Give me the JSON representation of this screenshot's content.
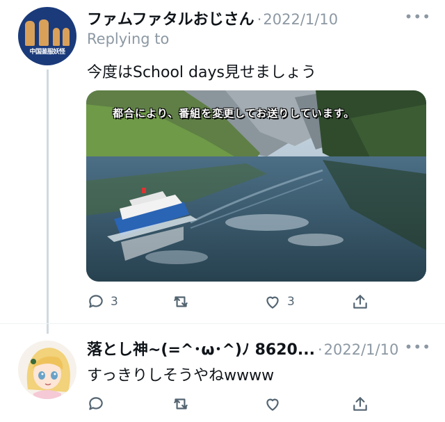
{
  "tweet1": {
    "display_name": "ファムファタルおじさん",
    "separator": "·",
    "date": "2022/1/10",
    "more_label": "•••",
    "replying_to": "Replying to",
    "text": "今度はSchool days見せましょう",
    "media_caption": "都合により、番組を変更してお送りしています。",
    "avatar_caption": "中国鉴服妖怪",
    "actions": {
      "reply_count": "3",
      "like_count": "3"
    }
  },
  "tweet2": {
    "display_name": "落とし神~(=^･ω･^)ﾉ 8620...",
    "separator": "·",
    "date": "2022/1/10",
    "more_label": "•••",
    "text": "すっきりしそうやねwwww"
  },
  "colors": {
    "text_primary": "#0f1419",
    "text_secondary": "#8c98a3",
    "icon": "#536471",
    "thread_line": "#cfd9de"
  },
  "icons": [
    "reply-icon",
    "retweet-icon",
    "like-icon",
    "share-icon",
    "more-icon"
  ]
}
